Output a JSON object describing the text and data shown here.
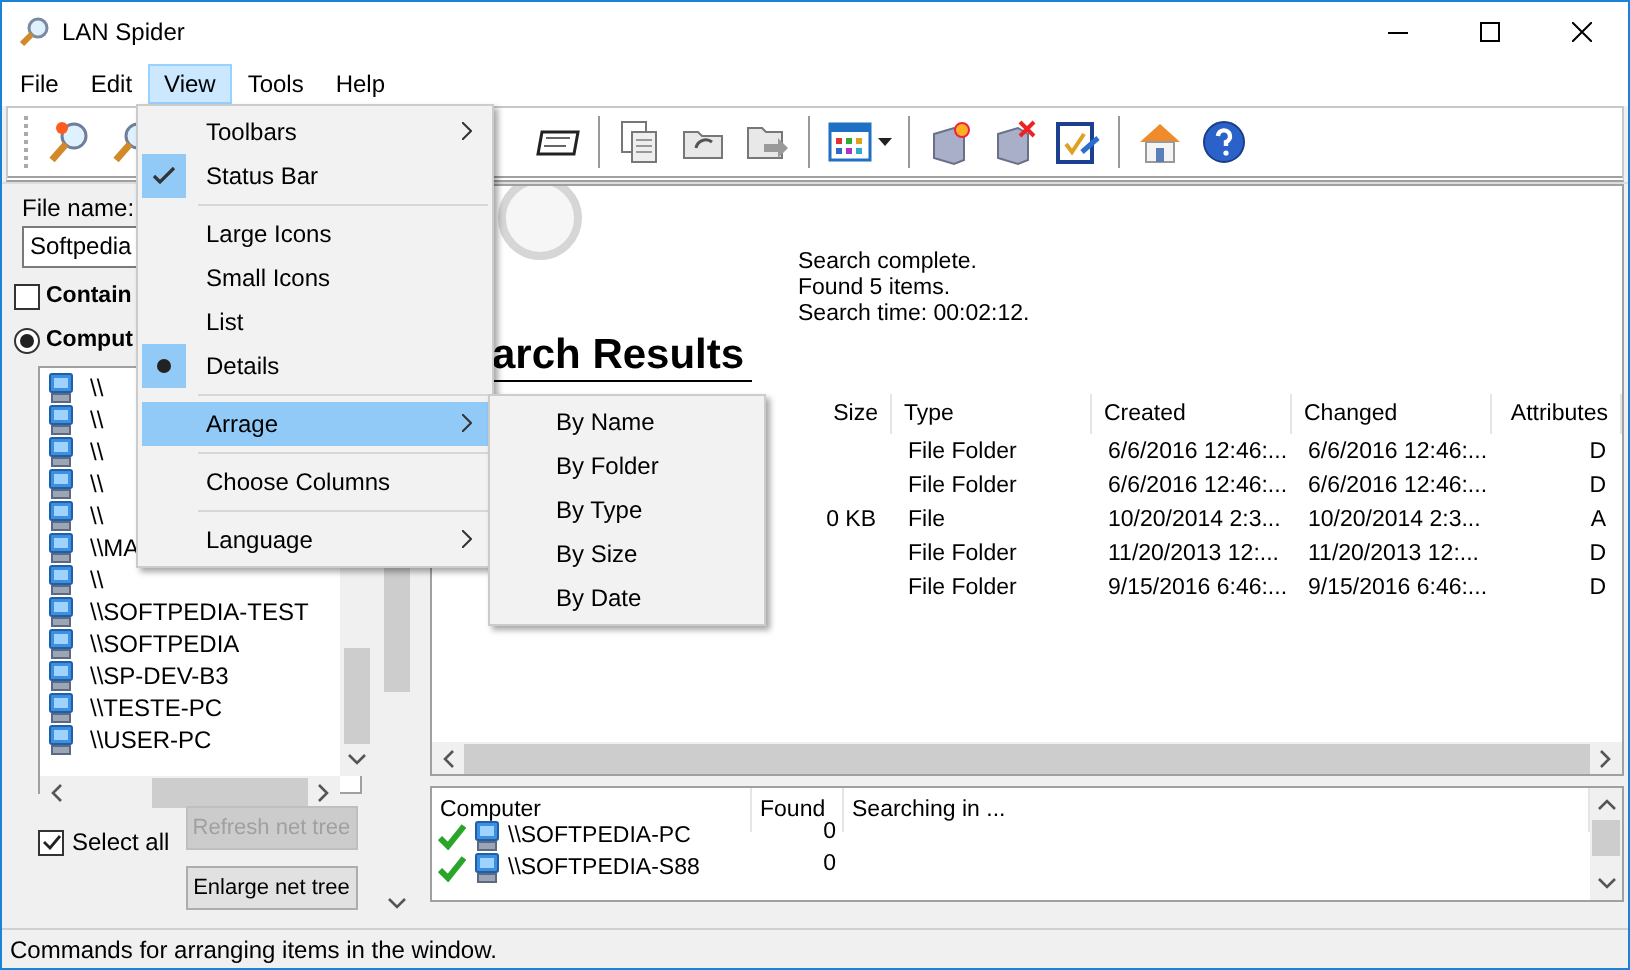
{
  "window": {
    "title": "LAN Spider"
  },
  "menubar": [
    {
      "label": "File",
      "selected": false
    },
    {
      "label": "Edit",
      "selected": false
    },
    {
      "label": "View",
      "selected": true
    },
    {
      "label": "Tools",
      "selected": false
    },
    {
      "label": "Help",
      "selected": false
    }
  ],
  "view_menu": [
    {
      "kind": "submenu",
      "label": "Toolbars",
      "selected": false
    },
    {
      "kind": "check",
      "label": "Status Bar",
      "checked": true,
      "selected": false
    },
    {
      "kind": "separator"
    },
    {
      "kind": "radio",
      "label": "Large Icons",
      "checked": false,
      "selected": false
    },
    {
      "kind": "radio",
      "label": "Small Icons",
      "checked": false,
      "selected": false
    },
    {
      "kind": "radio",
      "label": "List",
      "checked": false,
      "selected": false
    },
    {
      "kind": "radio",
      "label": "Details",
      "checked": true,
      "selected": false
    },
    {
      "kind": "separator"
    },
    {
      "kind": "submenu",
      "label": "Arrage",
      "selected": true
    },
    {
      "kind": "separator"
    },
    {
      "kind": "command",
      "label": "Choose Columns",
      "selected": false
    },
    {
      "kind": "separator"
    },
    {
      "kind": "submenu",
      "label": "Language",
      "selected": false
    }
  ],
  "arrange_submenu": [
    {
      "label": "By Name",
      "selected": false
    },
    {
      "label": "By Folder",
      "selected": false
    },
    {
      "label": "By Type",
      "selected": false
    },
    {
      "label": "By Size",
      "selected": false
    },
    {
      "label": "By Date",
      "selected": false
    }
  ],
  "left_panel": {
    "file_name_label": "File name:",
    "file_name_value": "Softpedia",
    "contain_checkbox": {
      "label": "Contain",
      "checked": false
    },
    "computer_radio": {
      "label": "Comput",
      "selected": true
    },
    "computers": [
      "\\\\",
      "\\\\",
      "\\\\",
      "\\\\",
      "\\\\",
      "\\\\MA",
      "\\\\",
      "\\\\SOFTPEDIA-TEST",
      "\\\\SOFTPEDIA",
      "\\\\SP-DEV-B3",
      "\\\\TESTE-PC",
      "\\\\USER-PC"
    ],
    "select_all": {
      "label": "Select all",
      "checked": true
    },
    "buttons": [
      {
        "label": "Refresh net tree",
        "disabled": true
      },
      {
        "label": "Enlarge net tree",
        "disabled": false
      }
    ]
  },
  "search_status": [
    "Search complete.",
    "Found 5 items.",
    "Search time: 00:02:12."
  ],
  "results": {
    "heading": "arch Results",
    "columns": [
      "Size",
      "Type",
      "Created",
      "Changed",
      "Attributes"
    ],
    "rows": [
      {
        "type": "File Folder",
        "created": "6/6/2016 12:46:...",
        "changed": "6/6/2016 12:46:...",
        "attributes": "D"
      },
      {
        "type": "File Folder",
        "created": "6/6/2016 12:46:...",
        "changed": "6/6/2016 12:46:...",
        "attributes": "D"
      },
      {
        "size": "0 KB",
        "type": "File",
        "created": "10/20/2014 2:3...",
        "changed": "10/20/2014 2:3...",
        "attributes": "A"
      },
      {
        "type": "File Folder",
        "created": "11/20/2013 12:...",
        "changed": "11/20/2013 12:...",
        "attributes": "D"
      },
      {
        "type": "File Folder",
        "created": "9/15/2016 6:46:...",
        "changed": "9/15/2016 6:46:...",
        "attributes": "D"
      }
    ]
  },
  "progress": {
    "columns": [
      "Computer",
      "Found",
      "Searching in ..."
    ],
    "rows": [
      {
        "computer": "\\\\SOFTPEDIA-PC",
        "found": "0",
        "done": true
      },
      {
        "computer": "\\\\SOFTPEDIA-S88",
        "found": "0",
        "done": true
      }
    ]
  },
  "status_bar": "Commands for arranging items in the window."
}
